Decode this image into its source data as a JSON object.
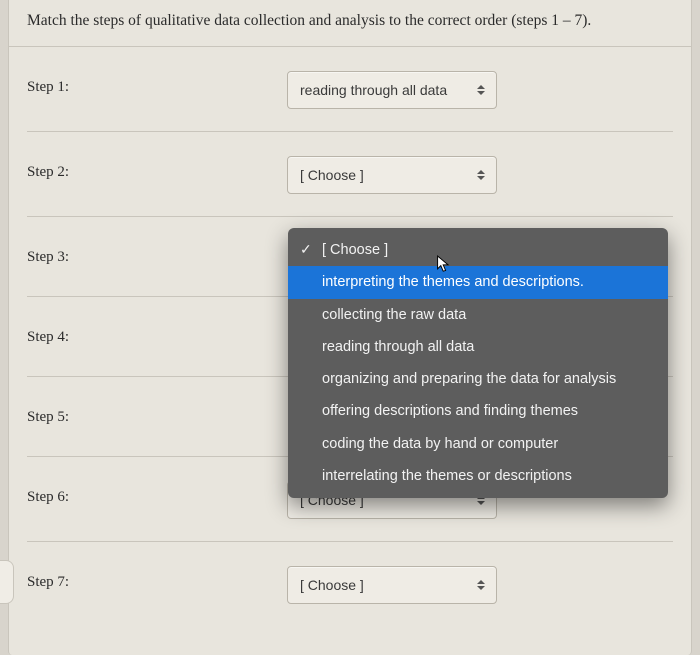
{
  "question": "Match the steps of qualitative data collection and analysis to the correct order (steps 1 – 7).",
  "placeholder": "[ Choose ]",
  "steps": [
    {
      "label": "Step 1:",
      "value": "reading through all data"
    },
    {
      "label": "Step 2:",
      "value": "[ Choose ]"
    },
    {
      "label": "Step 3:",
      "value": ""
    },
    {
      "label": "Step 4:",
      "value": ""
    },
    {
      "label": "Step 5:",
      "value": ""
    },
    {
      "label": "Step 6:",
      "value": "[ Choose ]"
    },
    {
      "label": "Step 7:",
      "value": "[ Choose ]"
    }
  ],
  "dropdown": {
    "options": [
      "[ Choose ]",
      "interpreting the themes and descriptions.",
      "collecting the raw data",
      "reading through all data",
      "organizing and preparing the data for analysis",
      "offering descriptions and finding themes",
      "coding the data by hand or computer",
      "interrelating the themes or descriptions"
    ],
    "selected_index": 0,
    "highlight_index": 1
  }
}
